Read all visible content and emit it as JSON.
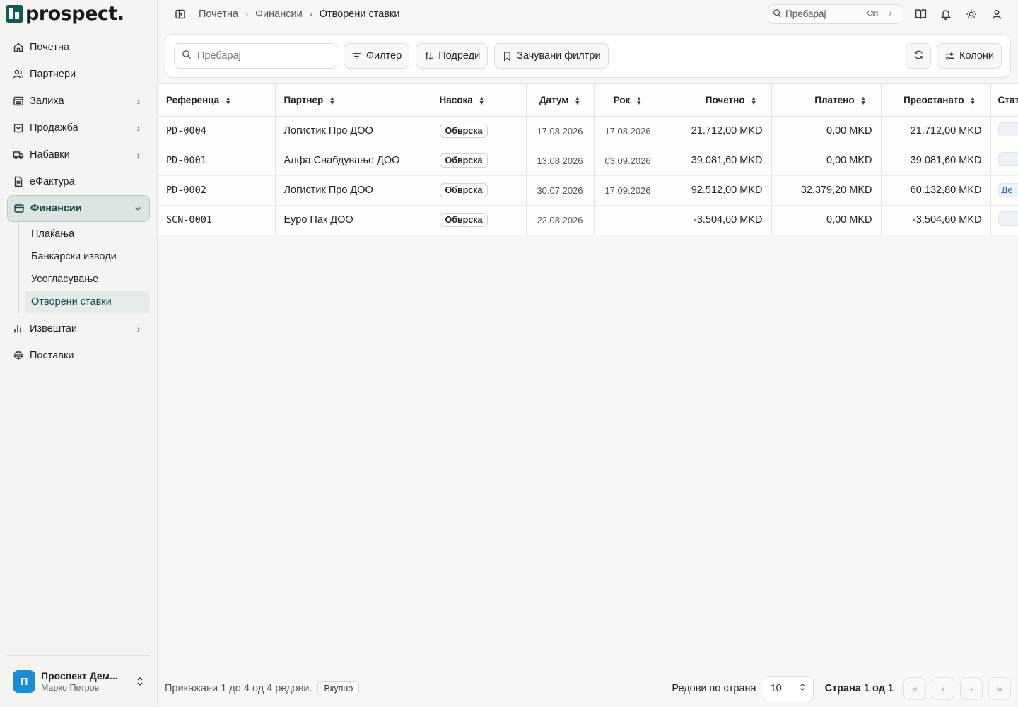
{
  "brand": {
    "name": "prospect."
  },
  "sidebar": {
    "items": [
      {
        "label": "Почетна",
        "icon": "home-icon"
      },
      {
        "label": "Партнери",
        "icon": "users-icon"
      },
      {
        "label": "Залиха",
        "icon": "inventory-icon"
      },
      {
        "label": "Продажба",
        "icon": "shopping-bag-icon"
      },
      {
        "label": "Набавки",
        "icon": "truck-icon"
      },
      {
        "label": "еФактура",
        "icon": "file-text-icon"
      },
      {
        "label": "Финансии",
        "icon": "wallet-icon"
      },
      {
        "label": "Извештаи",
        "icon": "bar-chart-icon"
      },
      {
        "label": "Поставки",
        "icon": "settings-icon"
      }
    ],
    "finance_sub": [
      "Плаќања",
      "Банкарски изводи",
      "Усогласување",
      "Отворени ставки"
    ],
    "user": {
      "initial": "П",
      "org": "Проспект Дем...",
      "name": "Марко Петров"
    }
  },
  "topbar": {
    "breadcrumb": [
      "Почетна",
      "Финансии",
      "Отворени ставки"
    ],
    "search_placeholder": "Пребарај",
    "shortcut_ctrl": "Ctrl",
    "shortcut_key": "/"
  },
  "toolbar": {
    "search_placeholder": "Пребарај",
    "filter": "Филтер",
    "sort": "Подреди",
    "saved_filters": "Зачувани филтри",
    "columns": "Колони"
  },
  "table": {
    "headers": [
      "Референца",
      "Партнер",
      "Насока",
      "Датум",
      "Рок",
      "Почетно",
      "Платено",
      "Преостанато",
      "Стат"
    ],
    "rows": [
      {
        "ref": "PD-0004",
        "partner": "Логистик Про ДОО",
        "direction": "Обврска",
        "date": "17.08.2026",
        "due": "17.08.2026",
        "initial": "21.712,00 MKD",
        "paid": "0,00 MKD",
        "remaining": "21.712,00 MKD",
        "status": ""
      },
      {
        "ref": "PD-0001",
        "partner": "Алфа Снабдување ДОО",
        "direction": "Обврска",
        "date": "13.08.2026",
        "due": "03.09.2026",
        "initial": "39.081,60 MKD",
        "paid": "0,00 MKD",
        "remaining": "39.081,60 MKD",
        "status": ""
      },
      {
        "ref": "PD-0002",
        "partner": "Логистик Про ДОО",
        "direction": "Обврска",
        "date": "30.07.2026",
        "due": "17.09.2026",
        "initial": "92.512,00 MKD",
        "paid": "32.379,20 MKD",
        "remaining": "60.132,80 MKD",
        "status": "Де"
      },
      {
        "ref": "SCN-0001",
        "partner": "Еуро Пак ДОО",
        "direction": "Обврска",
        "date": "22.08.2026",
        "due": "—",
        "initial": "-3.504,60 MKD",
        "paid": "0,00 MKD",
        "remaining": "-3.504,60 MKD",
        "status": ""
      }
    ]
  },
  "footer": {
    "info": "Прикажани 1 до 4 од 4 редови.",
    "total_badge": "Вкупно",
    "rows_per_page_label": "Редови по страна",
    "rows_per_page": "10",
    "page_info": "Страна 1 од 1"
  }
}
